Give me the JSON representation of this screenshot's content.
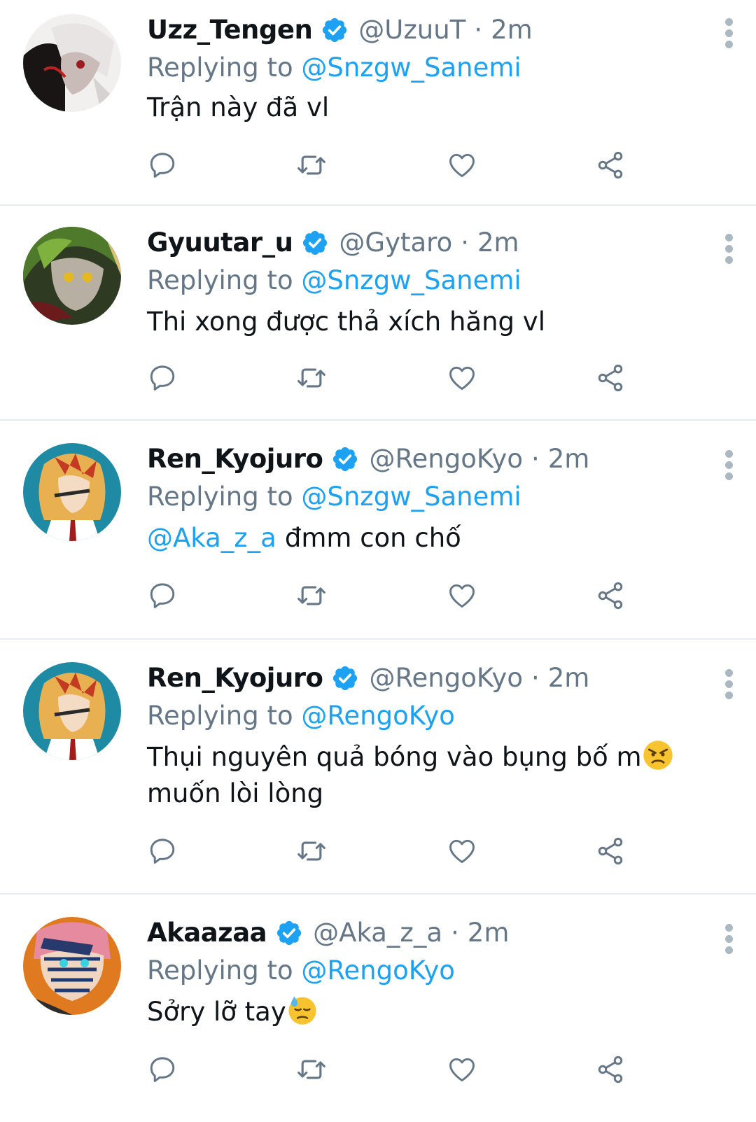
{
  "tweets": [
    {
      "name": "Uzz_Tengen",
      "handle": "@UzuuT",
      "time": "2m",
      "reply_prefix": "Replying to",
      "reply_to": "@Snzgw_Sanemi",
      "mention": "",
      "text": "Trận này đã vl"
    },
    {
      "name": "Gyuutar_u",
      "handle": "@Gytaro",
      "time": "2m",
      "reply_prefix": "Replying to",
      "reply_to": "@Snzgw_Sanemi",
      "mention": "",
      "text": "Thi xong được thả xích hăng vl"
    },
    {
      "name": "Ren_Kyojuro",
      "handle": "@RengoKyo",
      "time": "2m",
      "reply_prefix": "Replying to",
      "reply_to": "@Snzgw_Sanemi",
      "mention": "@Aka_z_a",
      "text": "đmm con chố"
    },
    {
      "name": "Ren_Kyojuro",
      "handle": "@RengoKyo",
      "time": "2m",
      "reply_prefix": "Replying to",
      "reply_to": "@RengoKyo",
      "mention": "",
      "text_before": "Thụi nguyên quả bóng vào bụng bố m",
      "text_after": " muốn lòi lòng",
      "emoji": "angry-face-emoji"
    },
    {
      "name": "Akaazaa",
      "handle": "@Aka_z_a",
      "time": "2m",
      "reply_prefix": "Replying to",
      "reply_to": "@RengoKyo",
      "mention": "",
      "text_before": "Sởry lỡ tay",
      "emoji": "downcast-sweat-emoji"
    }
  ],
  "separator": "·",
  "icons": {
    "verified": "verified-badge-icon",
    "reply": "reply-icon",
    "retweet": "retweet-icon",
    "like": "heart-icon",
    "share": "share-icon",
    "more": "more-vertical-icon"
  },
  "colors": {
    "accent": "#1da1f2",
    "secondary_text": "#657786",
    "divider": "#e6ecf0"
  }
}
